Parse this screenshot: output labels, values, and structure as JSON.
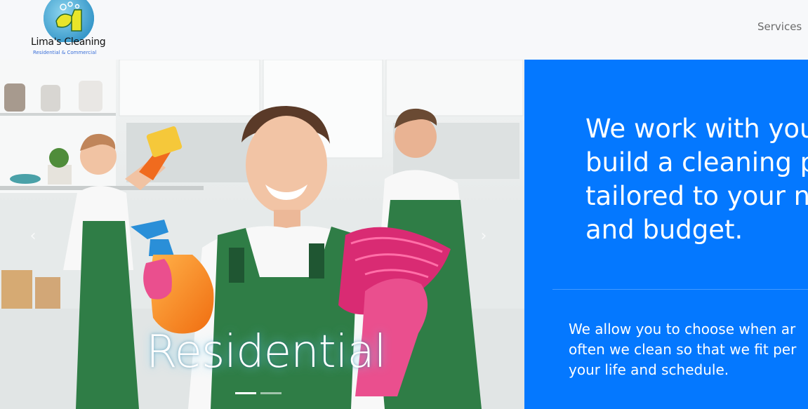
{
  "brand": {
    "name": "Lima's Cleaning",
    "tagline": "Residential & Commercial"
  },
  "nav": {
    "items": [
      {
        "label": "Services"
      }
    ]
  },
  "carousel": {
    "caption": "Residential",
    "prev_icon": "chevron-left-icon",
    "next_icon": "chevron-right-icon",
    "prev_glyph": "‹",
    "next_glyph": "›",
    "slide_count": 2,
    "active_slide": 1
  },
  "hero": {
    "headline_lines": [
      "We work with you",
      "build a cleaning pl",
      "tailored to your ne",
      "and budget."
    ],
    "body_lines": [
      "We allow you to choose when ar",
      "often we clean so that we fit per",
      "your life and schedule."
    ]
  },
  "colors": {
    "accent_blue": "#0478ff",
    "navbar_bg": "#f7f8fa",
    "nav_link": "#6b6b6b",
    "uniform_green": "#2f7d46",
    "glove_pink": "#ea4f8e"
  }
}
